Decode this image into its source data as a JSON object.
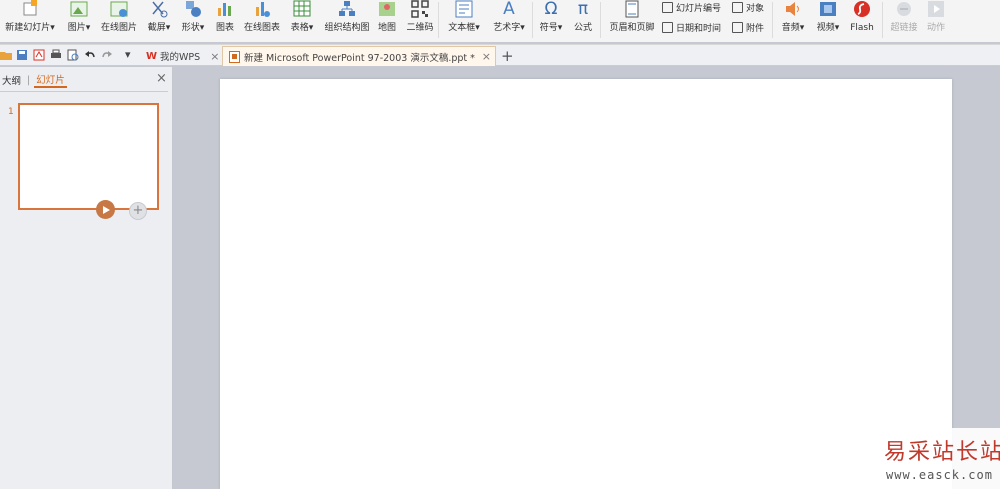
{
  "ribbon": {
    "items": [
      {
        "label": "新建幻灯片",
        "dropdown": true,
        "icon": "new-slide-icon"
      },
      {
        "label": "图片",
        "dropdown": true,
        "icon": "picture-icon"
      },
      {
        "label": "在线图片",
        "icon": "online-picture-icon"
      },
      {
        "label": "截屏",
        "dropdown": true,
        "icon": "screenshot-icon"
      },
      {
        "label": "形状",
        "dropdown": true,
        "icon": "shapes-icon"
      },
      {
        "label": "图表",
        "icon": "chart-icon"
      },
      {
        "label": "在线图表",
        "icon": "online-chart-icon"
      },
      {
        "label": "表格",
        "dropdown": true,
        "icon": "table-icon"
      },
      {
        "label": "组织结构图",
        "icon": "org-chart-icon"
      },
      {
        "label": "地图",
        "icon": "map-icon"
      },
      {
        "label": "二维码",
        "icon": "qr-code-icon"
      },
      {
        "label": "文本框",
        "dropdown": true,
        "icon": "text-box-icon"
      },
      {
        "label": "艺术字",
        "dropdown": true,
        "icon": "word-art-icon"
      },
      {
        "label": "符号",
        "dropdown": true,
        "icon": "omega-icon"
      },
      {
        "label": "公式",
        "icon": "pi-icon"
      },
      {
        "label": "页眉和页脚",
        "icon": "header-footer-icon"
      },
      {
        "label": "音频",
        "dropdown": true,
        "icon": "audio-icon"
      },
      {
        "label": "视频",
        "dropdown": true,
        "icon": "video-icon"
      },
      {
        "label": "Flash",
        "icon": "flash-icon"
      },
      {
        "label": "超链接",
        "icon": "hyperlink-icon",
        "disabled": true
      },
      {
        "label": "动作",
        "icon": "action-icon",
        "disabled": true
      }
    ],
    "small_items": [
      {
        "label": "幻灯片编号",
        "icon": "slide-number-icon"
      },
      {
        "label": "对象",
        "icon": "object-icon"
      },
      {
        "label": "日期和时间",
        "icon": "date-time-icon"
      },
      {
        "label": "附件",
        "icon": "attachment-icon"
      }
    ],
    "dropdown_caret": "▾",
    "glyphs": {
      "omega": "Ω",
      "pi": "π",
      "text_a": "A"
    }
  },
  "tabs": {
    "items": [
      {
        "label": "我的WPS",
        "active": false
      },
      {
        "label": "新建 Microsoft PowerPoint 97-2003 演示文稿.ppt *",
        "active": true
      }
    ],
    "close_glyph": "×",
    "add_glyph": "+",
    "menu_caret": "▾"
  },
  "left_pane": {
    "tab_outline": "大纲",
    "tab_slides": "幻灯片",
    "divider": "|",
    "close_glyph": "×",
    "slides": [
      {
        "number": "1"
      }
    ],
    "add_glyph": "+"
  },
  "watermark": {
    "text": "易采站长站",
    "url": "www.easck.com"
  },
  "colors": {
    "accent": "#d2691e",
    "workspace": "#c6c9d2",
    "ribbon_bg": "#f4f4f4"
  }
}
